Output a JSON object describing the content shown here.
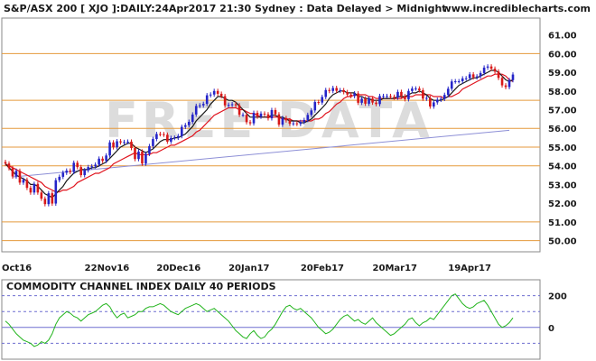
{
  "chart_data": [
    {
      "type": "candlestick",
      "title": "S&P/ASX 200 [ XJO ]:DAILY:24Apr2017 21:30 Sydney : Data Delayed > Midnight",
      "source": "www.incrediblecharts.com",
      "watermark": "FREE DATA",
      "x_ticks": [
        "Oct16",
        "22Nov16",
        "20Dec16",
        "20Jan17",
        "20Feb17",
        "20Mar17",
        "19Apr17"
      ],
      "y_ticks": [
        "61.00",
        "60.00",
        "59.00",
        "58.00",
        "57.00",
        "56.00",
        "55.00",
        "54.00",
        "53.00",
        "52.00",
        "51.00",
        "50.00"
      ],
      "ylim": [
        49.4,
        61.9
      ],
      "horizontal_levels": [
        60.0,
        57.5,
        56.0,
        55.0,
        54.0,
        51.0,
        50.0
      ],
      "trend_line": {
        "start": 53.4,
        "end": 55.9
      },
      "series": [
        {
          "name": "close",
          "values": [
            54.12,
            53.87,
            53.43,
            53.73,
            53.1,
            53.25,
            52.82,
            52.57,
            53.03,
            52.57,
            52.24,
            51.95,
            52.53,
            51.98,
            53.23,
            53.41,
            53.63,
            53.74,
            53.67,
            54.16,
            53.93,
            53.5,
            53.76,
            53.93,
            53.97,
            54.06,
            54.38,
            54.26,
            54.55,
            55.25,
            54.99,
            55.31,
            55.25,
            55.27,
            55.29,
            54.95,
            54.36,
            54.76,
            54.12,
            54.64,
            55.05,
            55.43,
            55.7,
            55.69,
            55.66,
            55.29,
            55.49,
            55.5,
            55.59,
            56.08,
            56.17,
            56.35,
            56.74,
            57.2,
            57.23,
            57.31,
            57.77,
            57.81,
            58.0,
            57.85,
            57.72,
            57.23,
            57.26,
            57.29,
            57.23,
            56.73,
            56.73,
            56.33,
            56.27,
            56.83,
            56.63,
            56.79,
            56.75,
            56.54,
            56.98,
            56.75,
            56.2,
            56.55,
            56.43,
            56.25,
            56.27,
            56.24,
            56.34,
            56.45,
            56.72,
            56.96,
            57.41,
            57.38,
            57.68,
            58.05,
            58.0,
            58.16,
            58.01,
            58.04,
            57.94,
            57.81,
            57.73,
            57.87,
            57.37,
            57.59,
            57.32,
            57.6,
            57.38,
            57.3,
            57.73,
            57.73,
            57.73,
            57.69,
            57.65,
            57.95,
            57.72,
            57.56,
            58.0,
            58.13,
            58.13,
            58.04,
            57.59,
            57.63,
            57.17,
            57.39,
            57.53,
            57.58,
            57.79,
            58.12,
            58.51,
            58.52,
            58.52,
            58.67,
            58.68,
            58.89,
            58.73,
            58.78,
            58.96,
            59.25,
            59.31,
            59.19,
            59.04,
            58.7,
            58.3,
            58.21,
            58.58,
            58.88
          ]
        },
        {
          "name": "fast-average",
          "values": [
            54.1,
            53.9,
            53.7,
            53.5,
            53.4,
            53.3,
            53.2,
            53.0,
            53.0,
            52.9,
            52.7,
            52.5,
            52.4,
            52.3,
            52.5,
            52.7,
            52.9,
            53.2,
            53.4,
            53.6,
            53.7,
            53.8,
            53.8,
            53.8,
            53.9,
            53.9,
            54.0,
            54.1,
            54.2,
            54.4,
            54.6,
            54.8,
            55.0,
            55.1,
            55.2,
            55.2,
            55.0,
            54.9,
            54.8,
            54.7,
            54.8,
            54.9,
            55.1,
            55.3,
            55.4,
            55.4,
            55.4,
            55.5,
            55.5,
            55.6,
            55.7,
            55.9,
            56.1,
            56.4,
            56.6,
            56.8,
            57.0,
            57.3,
            57.5,
            57.7,
            57.7,
            57.6,
            57.5,
            57.5,
            57.4,
            57.2,
            57.0,
            56.8,
            56.6,
            56.6,
            56.6,
            56.6,
            56.6,
            56.6,
            56.7,
            56.7,
            56.6,
            56.6,
            56.5,
            56.4,
            56.4,
            56.4,
            56.3,
            56.3,
            56.4,
            56.5,
            56.7,
            56.9,
            57.1,
            57.3,
            57.6,
            57.8,
            57.9,
            58.0,
            58.0,
            57.9,
            57.9,
            57.9,
            57.7,
            57.7,
            57.6,
            57.6,
            57.5,
            57.5,
            57.5,
            57.6,
            57.6,
            57.6,
            57.6,
            57.7,
            57.7,
            57.7,
            57.8,
            57.9,
            57.9,
            58.0,
            57.9,
            57.8,
            57.6,
            57.5,
            57.5,
            57.5,
            57.6,
            57.7,
            57.9,
            58.1,
            58.3,
            58.4,
            58.5,
            58.6,
            58.7,
            58.7,
            58.8,
            58.9,
            59.0,
            59.1,
            59.1,
            59.0,
            58.8,
            58.6,
            58.5,
            58.6
          ]
        },
        {
          "name": "slow-average",
          "values": [
            54.1,
            54.0,
            53.9,
            53.8,
            53.7,
            53.6,
            53.5,
            53.4,
            53.3,
            53.2,
            53.1,
            52.9,
            52.8,
            52.7,
            52.6,
            52.6,
            52.7,
            52.7,
            52.8,
            52.9,
            53.1,
            53.2,
            53.3,
            53.4,
            53.5,
            53.6,
            53.6,
            53.7,
            53.8,
            53.9,
            54.1,
            54.2,
            54.3,
            54.4,
            54.5,
            54.6,
            54.7,
            54.6,
            54.6,
            54.6,
            54.6,
            54.7,
            54.7,
            54.8,
            54.9,
            55.0,
            55.1,
            55.1,
            55.2,
            55.3,
            55.4,
            55.5,
            55.6,
            55.8,
            55.9,
            56.1,
            56.3,
            56.5,
            56.7,
            56.8,
            56.9,
            57.0,
            57.1,
            57.1,
            57.1,
            57.0,
            57.0,
            56.9,
            56.8,
            56.8,
            56.7,
            56.6,
            56.6,
            56.6,
            56.6,
            56.6,
            56.6,
            56.5,
            56.5,
            56.5,
            56.4,
            56.4,
            56.4,
            56.4,
            56.4,
            56.4,
            56.5,
            56.5,
            56.6,
            56.8,
            56.9,
            57.1,
            57.3,
            57.4,
            57.6,
            57.7,
            57.7,
            57.8,
            57.8,
            57.8,
            57.8,
            57.7,
            57.7,
            57.6,
            57.6,
            57.6,
            57.6,
            57.6,
            57.6,
            57.6,
            57.6,
            57.7,
            57.7,
            57.7,
            57.8,
            57.8,
            57.8,
            57.8,
            57.8,
            57.7,
            57.7,
            57.7,
            57.6,
            57.7,
            57.7,
            57.8,
            57.9,
            58.1,
            58.2,
            58.3,
            58.4,
            58.5,
            58.6,
            58.7,
            58.8,
            58.8,
            58.9,
            58.9,
            58.9,
            58.8,
            58.6,
            58.5
          ]
        }
      ]
    },
    {
      "type": "line",
      "title": "COMMODITY CHANNEL INDEX DAILY 40 PERIODS",
      "y_ticks": [
        "200",
        "0"
      ],
      "ylim": [
        -200,
        300
      ],
      "reference_lines": [
        200,
        100,
        0,
        -100
      ],
      "series": [
        {
          "name": "CCI",
          "values": [
            40,
            20,
            -10,
            -40,
            -60,
            -80,
            -90,
            -100,
            -120,
            -110,
            -90,
            -100,
            -80,
            -40,
            20,
            60,
            80,
            100,
            90,
            70,
            60,
            40,
            60,
            80,
            90,
            100,
            120,
            140,
            150,
            130,
            90,
            60,
            80,
            90,
            60,
            70,
            80,
            100,
            100,
            120,
            130,
            130,
            140,
            150,
            140,
            120,
            100,
            90,
            80,
            100,
            120,
            130,
            140,
            150,
            140,
            120,
            100,
            110,
            120,
            100,
            80,
            60,
            40,
            10,
            -20,
            -40,
            -60,
            -70,
            -40,
            -20,
            -50,
            -70,
            -60,
            -30,
            -10,
            20,
            60,
            100,
            130,
            140,
            120,
            110,
            120,
            100,
            80,
            60,
            30,
            0,
            -20,
            -40,
            -30,
            -10,
            20,
            50,
            70,
            80,
            60,
            40,
            50,
            30,
            20,
            40,
            60,
            30,
            10,
            -10,
            -30,
            -50,
            -40,
            -20,
            0,
            20,
            50,
            60,
            30,
            10,
            30,
            40,
            60,
            50,
            80,
            110,
            140,
            170,
            200,
            210,
            180,
            150,
            130,
            120,
            130,
            150,
            160,
            170,
            140,
            100,
            60,
            20,
            0,
            10,
            30,
            60
          ]
        }
      ]
    }
  ]
}
